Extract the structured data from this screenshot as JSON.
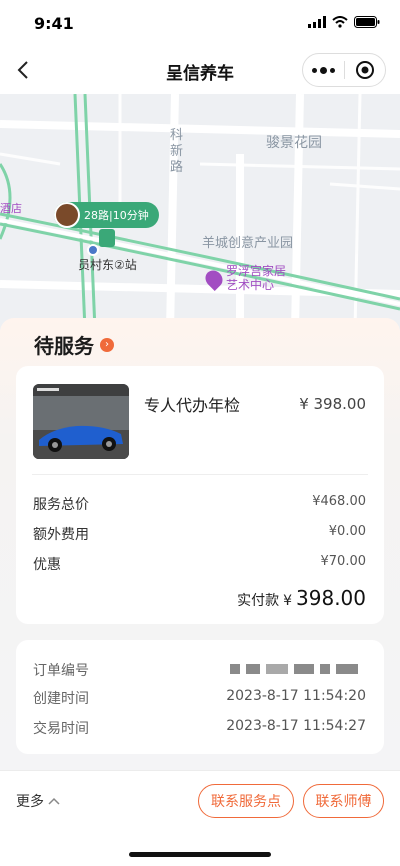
{
  "status_bar": {
    "time": "9:41"
  },
  "nav": {
    "title": "呈信养车"
  },
  "map": {
    "labels": {
      "road": "科\n新\n路",
      "garden": "骏景花园",
      "park": "羊城创意产业园",
      "hotel": "酒店",
      "station": "员村东②站",
      "poi": "罗浮宫家居\n艺术中心",
      "bus": "28路|10分钟"
    }
  },
  "order": {
    "status_label": "待服务",
    "service_name": "专人代办年检",
    "service_price": "¥ 398.00",
    "rows": [
      {
        "label": "服务总价",
        "value": "¥468.00"
      },
      {
        "label": "额外费用",
        "value": "¥0.00"
      },
      {
        "label": "优惠",
        "value": "¥70.00"
      }
    ],
    "paid_label": "实付款",
    "paid_currency": "¥",
    "paid_amount": "398.00"
  },
  "info": {
    "rows": [
      {
        "label": "订单编号",
        "value": ""
      },
      {
        "label": "创建时间",
        "value": "2023-8-17 11:54:20"
      },
      {
        "label": "交易时间",
        "value": "2023-8-17 11:54:27"
      }
    ]
  },
  "bottom": {
    "more": "更多",
    "contact_service_point": "联系服务点",
    "contact_master": "联系师傅"
  },
  "colors": {
    "accent": "#f06a3a",
    "map_bg": "#eef0f3",
    "green": "#3aa878"
  }
}
